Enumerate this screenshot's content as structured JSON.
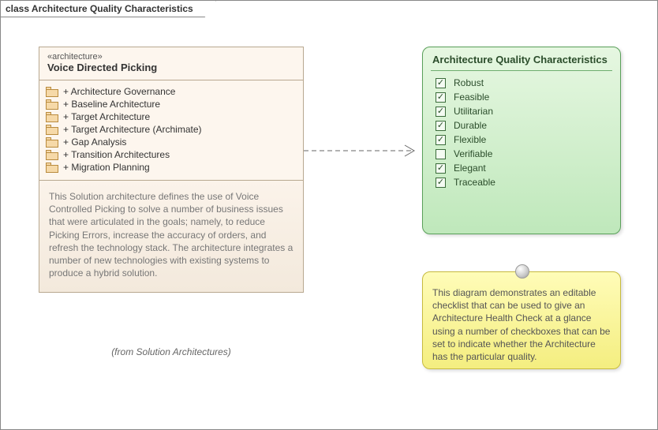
{
  "frame": {
    "title": "class Architecture Quality Characteristics"
  },
  "architecture": {
    "stereotype": "«architecture»",
    "name": "Voice Directed Picking",
    "members": [
      "+ Architecture Governance",
      "+ Baseline Architecture",
      "+ Target Architecture",
      "+ Target Architecture (Archimate)",
      "+ Gap Analysis",
      "+ Transition Architectures",
      "+ Migration Planning"
    ],
    "description": "This Solution architecture defines the use of Voice Controlled Picking to solve a number of business issues that were articulated in the goals; namely, to reduce Picking Errors, increase the accuracy of orders, and refresh the technology stack. The architecture integrates a number of new technologies with existing systems to produce a hybrid solution.",
    "from": "(from Solution Architectures)"
  },
  "checklist": {
    "title": "Architecture Quality Characteristics",
    "items": [
      {
        "label": "Robust",
        "checked": true
      },
      {
        "label": "Feasible",
        "checked": true
      },
      {
        "label": "Utilitarian",
        "checked": true
      },
      {
        "label": "Durable",
        "checked": true
      },
      {
        "label": "Flexible",
        "checked": true
      },
      {
        "label": "Verifiable",
        "checked": false
      },
      {
        "label": "Elegant",
        "checked": true
      },
      {
        "label": "Traceable",
        "checked": true
      }
    ]
  },
  "note": {
    "text": "This diagram demonstrates an editable checklist that can be used to give an Architecture Health Check at a glance using a number of checkboxes that can be set to indicate whether the Architecture has the particular quality."
  }
}
